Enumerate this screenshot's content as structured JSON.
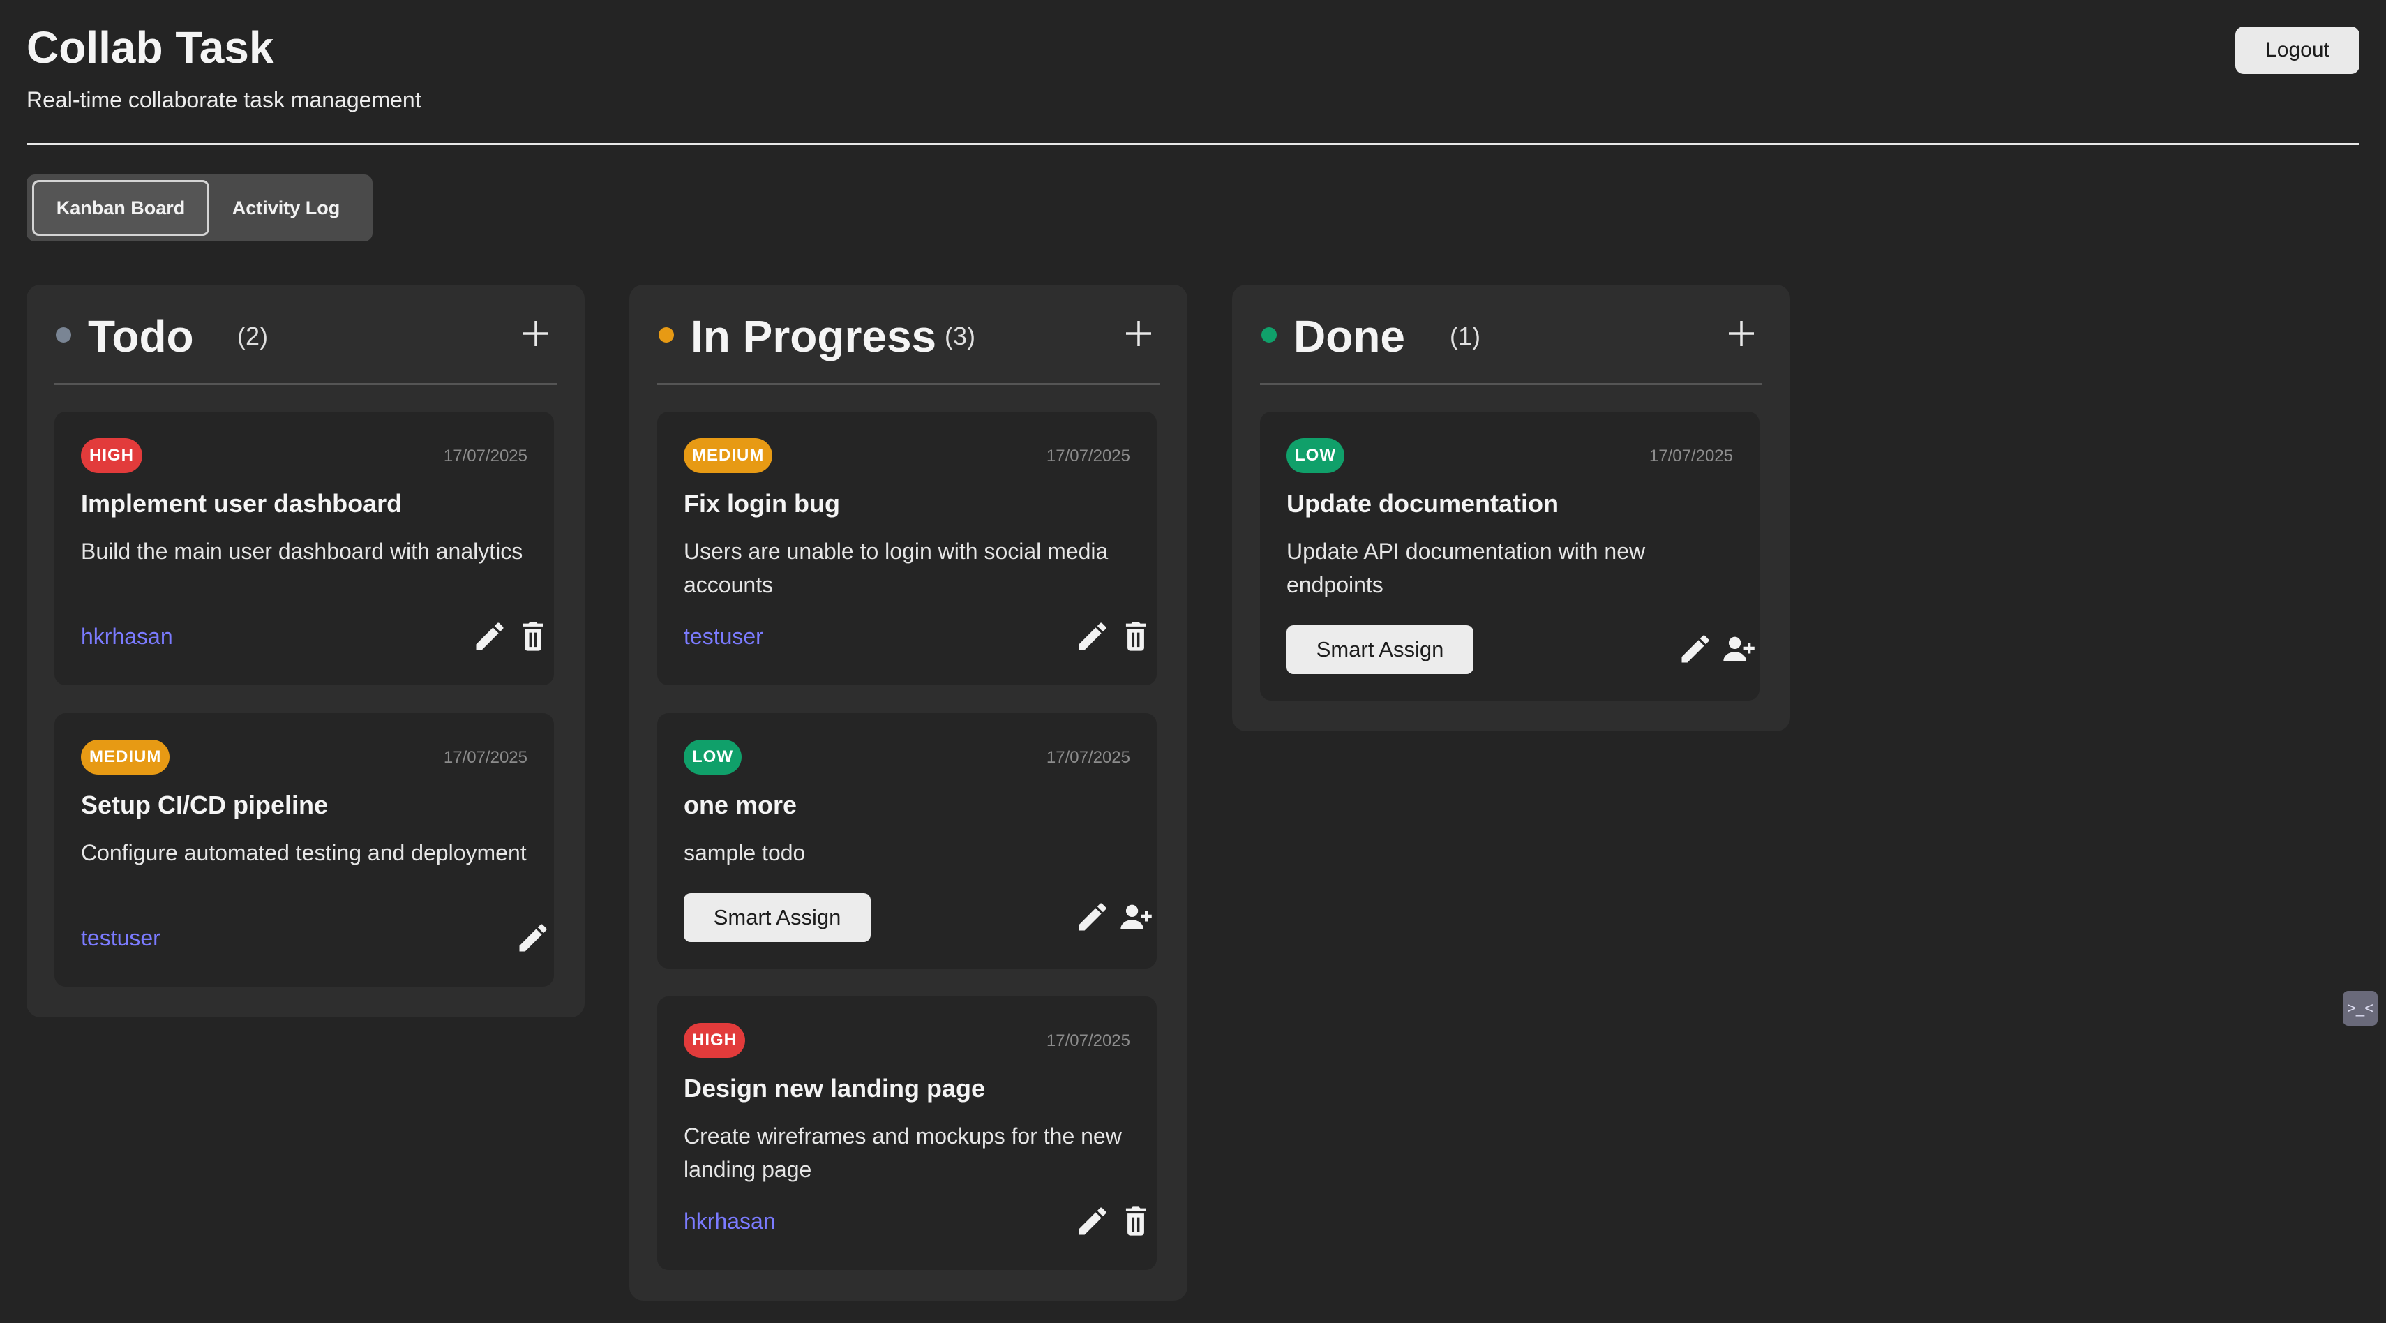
{
  "app": {
    "title": "Collab Task",
    "subtitle": "Real-time collaborate task management",
    "logout_label": "Logout"
  },
  "tabs": [
    {
      "label": "Kanban Board",
      "active": true
    },
    {
      "label": "Activity Log",
      "active": false
    }
  ],
  "colors": {
    "background": "#242424",
    "todo_dot": "#7a8594",
    "progress_dot": "#e79a14",
    "done_dot": "#10a06a",
    "priority_high": "#e23b3b",
    "priority_medium": "#e79a14",
    "priority_low": "#10a06a",
    "assignee": "#7b7bff"
  },
  "columns": [
    {
      "title": "Todo",
      "count": "(2)",
      "add_icon": "plus-icon",
      "cards": [
        {
          "priority": "HIGH",
          "date": "17/07/2025",
          "title": "Implement user dashboard",
          "description": "Build the main user dashboard with analytics",
          "assignee": "hkrhasan",
          "actions": [
            "pencil-icon",
            "trash-icon"
          ]
        },
        {
          "priority": "MEDIUM",
          "date": "17/07/2025",
          "title": "Setup CI/CD pipeline",
          "description": "Configure automated testing and deployment",
          "assignee": "testuser",
          "actions": [
            "pencil-icon"
          ]
        }
      ]
    },
    {
      "title": "In Progress",
      "count": "(3)",
      "add_icon": "plus-icon",
      "cards": [
        {
          "priority": "MEDIUM",
          "date": "17/07/2025",
          "title": "Fix login bug",
          "description": "Users are unable to login with social media accounts",
          "assignee": "testuser",
          "actions": [
            "pencil-icon",
            "trash-icon"
          ]
        },
        {
          "priority": "LOW",
          "date": "17/07/2025",
          "title": "one more",
          "description": "sample todo",
          "smart_assign_label": "Smart Assign",
          "actions": [
            "pencil-icon",
            "add-user-icon"
          ]
        },
        {
          "priority": "HIGH",
          "date": "17/07/2025",
          "title": "Design new landing page",
          "description": "Create wireframes and mockups for the new landing page",
          "assignee": "hkrhasan",
          "actions": [
            "pencil-icon",
            "trash-icon"
          ]
        }
      ]
    },
    {
      "title": "Done",
      "count": "(1)",
      "add_icon": "plus-icon",
      "cards": [
        {
          "priority": "LOW",
          "date": "17/07/2025",
          "title": "Update documentation",
          "description": "Update API documentation with new endpoints",
          "smart_assign_label": "Smart Assign",
          "actions": [
            "pencil-icon",
            "add-user-icon"
          ]
        }
      ]
    }
  ],
  "side_widget": {
    "icon": "extension-icon",
    "glyph": ">_<"
  }
}
